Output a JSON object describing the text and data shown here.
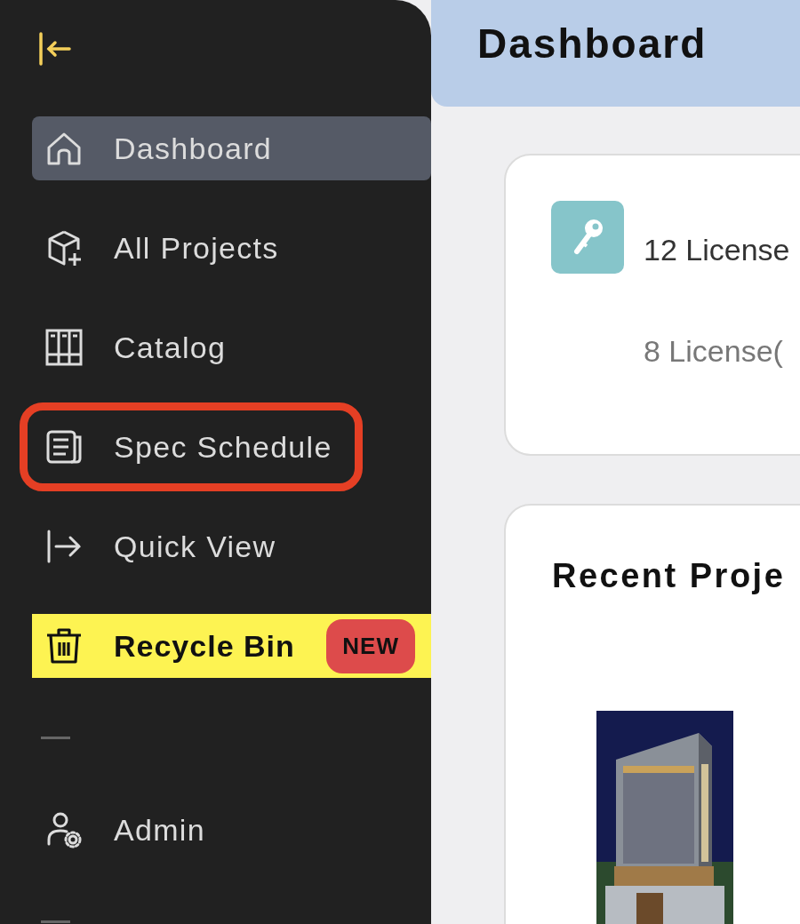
{
  "sidebar": {
    "items": [
      {
        "kind": "link",
        "label": "Dashboard",
        "selected": true,
        "outlined": false,
        "marked": false
      },
      {
        "kind": "link",
        "label": "All Projects",
        "selected": false,
        "outlined": false,
        "marked": false
      },
      {
        "kind": "link",
        "label": "Catalog",
        "selected": false,
        "outlined": false,
        "marked": false
      },
      {
        "kind": "link",
        "label": "Spec Schedule",
        "selected": false,
        "outlined": true,
        "marked": false
      },
      {
        "kind": "link",
        "label": "Quick View",
        "selected": false,
        "outlined": false,
        "marked": false
      },
      {
        "kind": "link",
        "label": "Recycle Bin",
        "selected": false,
        "outlined": false,
        "marked": true,
        "badge": "NEW"
      },
      {
        "kind": "divider"
      },
      {
        "kind": "link",
        "label": "Admin",
        "selected": false,
        "outlined": false,
        "marked": false
      },
      {
        "kind": "divider"
      }
    ]
  },
  "header": {
    "title": "Dashboard"
  },
  "license_card": {
    "total": "12 License",
    "used": "8 License("
  },
  "recent_projects": {
    "title": "Recent Proje"
  }
}
